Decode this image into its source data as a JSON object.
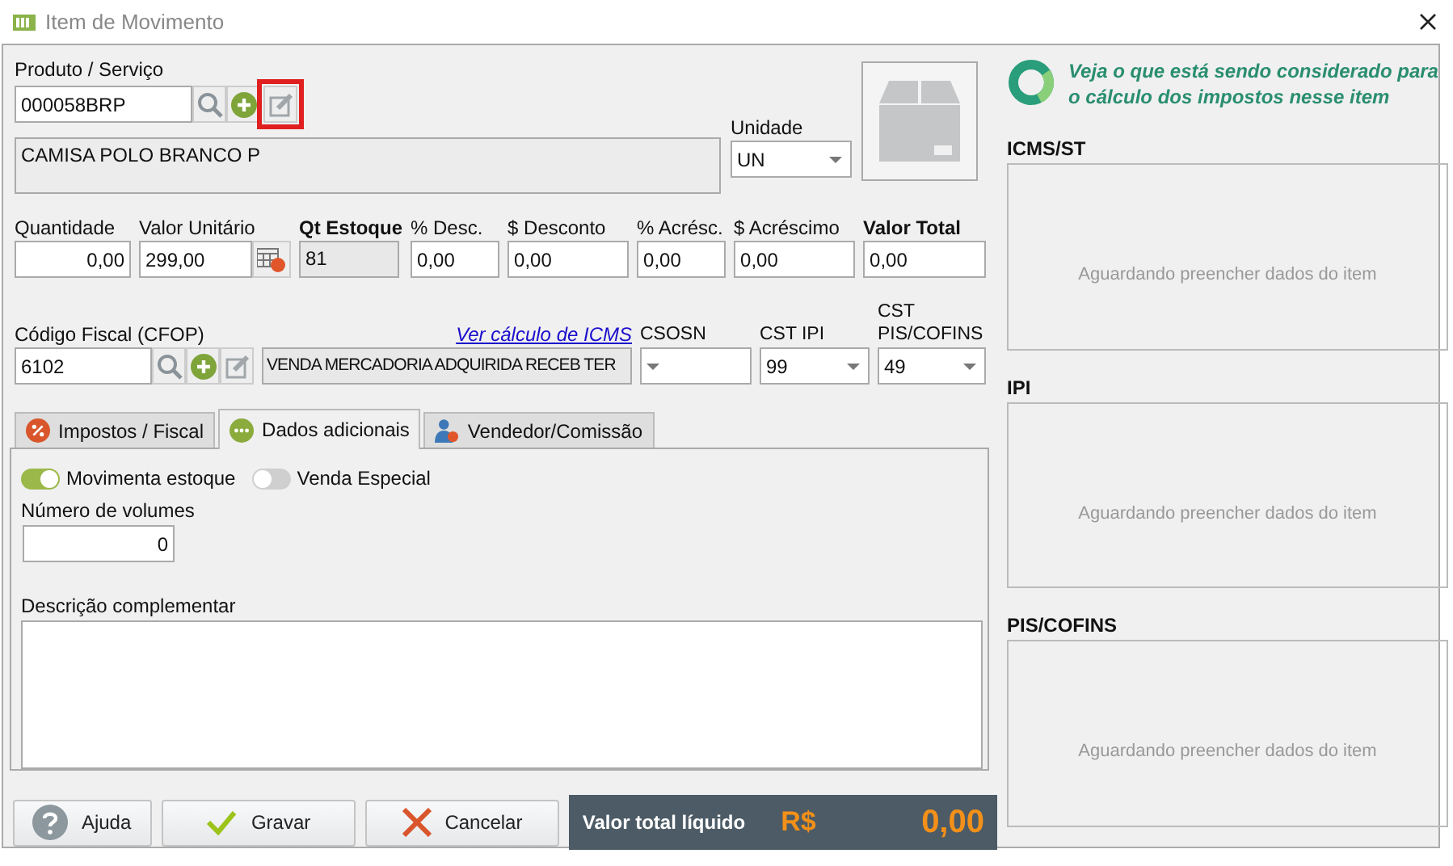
{
  "window": {
    "title": "Item de Movimento"
  },
  "product": {
    "label": "Produto / Serviço",
    "code": "000058BRP",
    "edit_highlighted": true,
    "description": "CAMISA POLO BRANCO P"
  },
  "unit": {
    "label": "Unidade",
    "value": "UN"
  },
  "values": [
    {
      "label": "Quantidade",
      "value": "0,00",
      "kind": "number",
      "emphasis": false
    },
    {
      "label": "Valor Unitário",
      "value": "299,00",
      "kind": "calc",
      "emphasis": false
    },
    {
      "label": "Qt Estoque",
      "value": "81",
      "kind": "readonly",
      "emphasis": true
    },
    {
      "label": "% Desc.",
      "value": "0,00",
      "kind": "text",
      "emphasis": false
    },
    {
      "label": "$ Desconto",
      "value": "0,00",
      "kind": "text",
      "emphasis": false
    },
    {
      "label": "% Acrésc.",
      "value": "0,00",
      "kind": "text",
      "emphasis": false
    },
    {
      "label": "$ Acréscimo",
      "value": "0,00",
      "kind": "text",
      "emphasis": false
    },
    {
      "label": "Valor Total",
      "value": "0,00",
      "kind": "text",
      "emphasis": true
    }
  ],
  "fiscal": {
    "label": "Código Fiscal (CFOP)",
    "code": "6102",
    "link": "Ver cálculo de ICMS",
    "description": "VENDA MERCADORIA ADQUIRIDA RECEB TER"
  },
  "selects": [
    {
      "label": "CSOSN"
    },
    {
      "label": "CST IPI",
      "value": "99"
    },
    {
      "label": "CST PIS/COFINS",
      "value": "49"
    }
  ],
  "tabs": [
    {
      "label": "Impostos / Fiscal",
      "kind": "percent",
      "selected": false
    },
    {
      "label": "Dados adicionais",
      "kind": "more",
      "selected": true
    },
    {
      "label": "Vendedor/Comissão",
      "kind": "person",
      "selected": false
    }
  ],
  "toggles": [
    {
      "label": "Movimenta estoque",
      "on": true
    },
    {
      "label": "Venda Especial",
      "on": false
    }
  ],
  "volumes": {
    "label": "Número de volumes",
    "value": "0"
  },
  "notes": {
    "label": "Descrição complementar"
  },
  "buttons": [
    {
      "label": "Ajuda",
      "kind": "help"
    },
    {
      "label": "Gravar",
      "kind": "save"
    },
    {
      "label": "Cancelar",
      "kind": "cancel"
    }
  ],
  "total": {
    "label": "Valor total líquido",
    "currency": "R$",
    "value": "0,00"
  },
  "tax_panel": {
    "hint": "Veja o que está sendo considerado para o cálculo dos impostos nesse item",
    "sections": [
      {
        "title": "ICMS/ST",
        "message": "Aguardando preencher dados do item"
      },
      {
        "title": "IPI",
        "message": "Aguardando preencher dados do item"
      },
      {
        "title": "PIS/COFINS",
        "message": "Aguardando preencher dados do item"
      }
    ]
  }
}
